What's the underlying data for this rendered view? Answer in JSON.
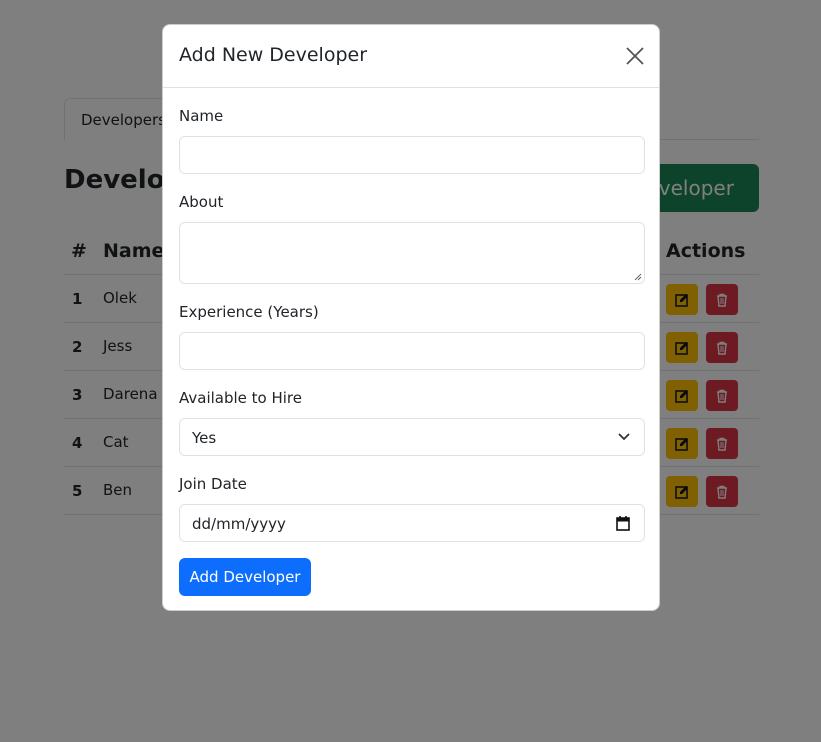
{
  "tabs": [
    {
      "label": "Developers"
    }
  ],
  "page": {
    "title": "Developers",
    "add_button_label": "Add Developer"
  },
  "table": {
    "headers": [
      "#",
      "Name",
      "Actions"
    ],
    "rows": [
      {
        "num": "1",
        "name": "Olek"
      },
      {
        "num": "2",
        "name": "Jess"
      },
      {
        "num": "3",
        "name": "Darena"
      },
      {
        "num": "4",
        "name": "Cat"
      },
      {
        "num": "5",
        "name": "Ben"
      }
    ]
  },
  "modal": {
    "title": "Add New Developer",
    "name_label": "Name",
    "name_value": "",
    "about_label": "About",
    "about_value": "",
    "experience_label": "Experience (Years)",
    "experience_value": "",
    "available_label": "Available to Hire",
    "available_value": "Yes",
    "join_date_label": "Join Date",
    "join_date_placeholder": "dd/mm/yyyy",
    "submit_label": "Add Developer"
  },
  "colors": {
    "primary": "#0d6efd",
    "success": "#198754",
    "warning": "#ffc107",
    "danger": "#dc3545"
  }
}
